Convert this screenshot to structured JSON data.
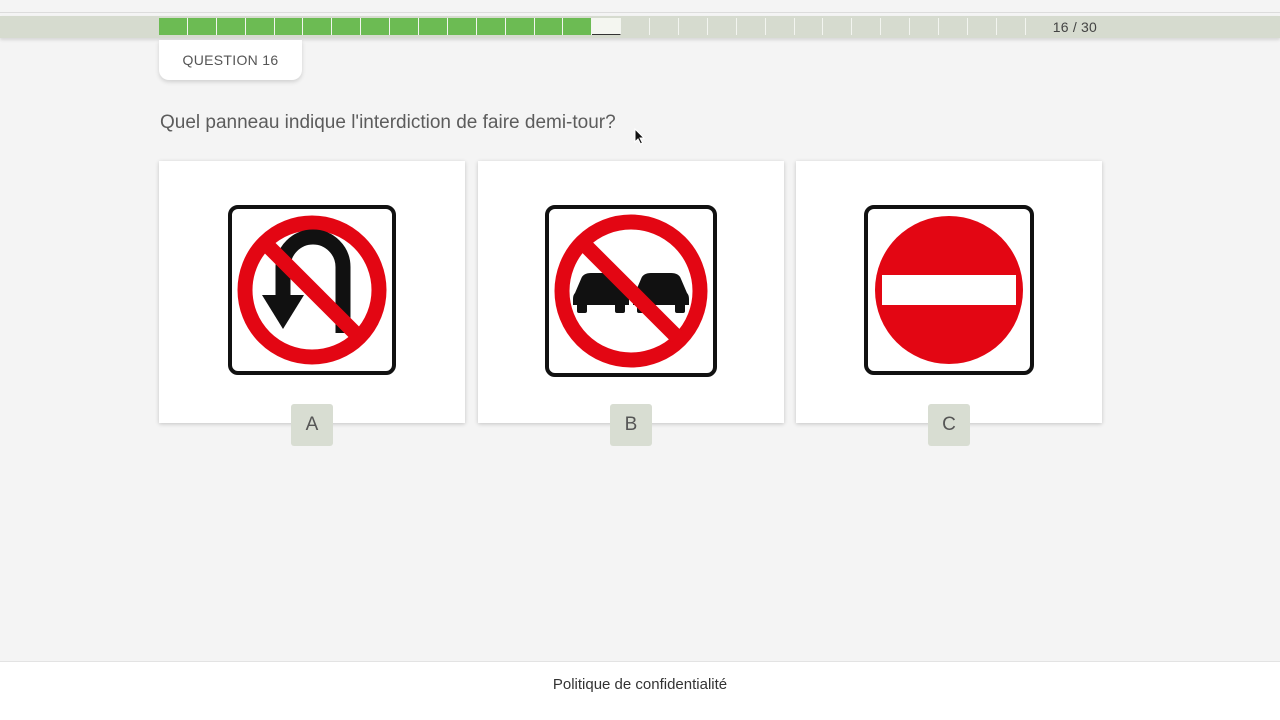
{
  "progress": {
    "label": "16 / 30",
    "current": 16,
    "total": 30,
    "completed": 15,
    "color_done": "#6cbb53",
    "color_current": "#f4f6f0",
    "color_remaining": "#d6dbcf"
  },
  "question": {
    "tab_label": "QUESTION 16",
    "text": "Quel panneau indique l'interdiction de faire demi-tour?"
  },
  "options": [
    {
      "letter": "A",
      "icon": "no-u-turn-sign-icon"
    },
    {
      "letter": "B",
      "icon": "no-passing-sign-icon"
    },
    {
      "letter": "C",
      "icon": "do-not-enter-sign-icon"
    }
  ],
  "colors": {
    "sign_red": "#e30613",
    "sign_black": "#111111",
    "badge_bg": "#d8ddd2"
  },
  "footer": {
    "privacy_link": "Politique de confidentialité"
  }
}
